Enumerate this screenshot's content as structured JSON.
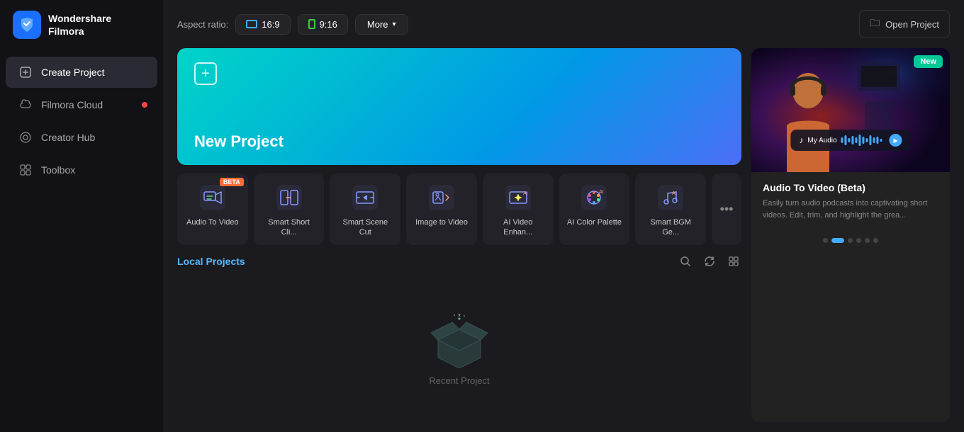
{
  "sidebar": {
    "logo": {
      "icon": "◆",
      "line1": "Wondershare",
      "line2": "Filmora"
    },
    "items": [
      {
        "id": "create-project",
        "label": "Create Project",
        "icon": "⊕",
        "active": true,
        "dot": false
      },
      {
        "id": "filmora-cloud",
        "label": "Filmora Cloud",
        "icon": "☁",
        "active": false,
        "dot": true
      },
      {
        "id": "creator-hub",
        "label": "Creator Hub",
        "icon": "◎",
        "active": false,
        "dot": false
      },
      {
        "id": "toolbox",
        "label": "Toolbox",
        "icon": "⊞",
        "active": false,
        "dot": false
      }
    ]
  },
  "topbar": {
    "aspect_label": "Aspect ratio:",
    "ratio_16_9": "16:9",
    "ratio_9_16": "9:16",
    "more_label": "More",
    "open_project_label": "Open Project"
  },
  "new_project": {
    "title": "New Project"
  },
  "ai_tools": [
    {
      "id": "audio-to-video",
      "label": "Audio To Video",
      "icon": "🎬",
      "beta": true
    },
    {
      "id": "smart-short-clip",
      "label": "Smart Short Cli...",
      "icon": "✂",
      "beta": false
    },
    {
      "id": "smart-scene-cut",
      "label": "Smart Scene Cut",
      "icon": "▶",
      "beta": false
    },
    {
      "id": "image-to-video",
      "label": "Image to Video",
      "icon": "🖼",
      "beta": false
    },
    {
      "id": "ai-video-enhance",
      "label": "AI Video Enhan...",
      "icon": "✦",
      "beta": false
    },
    {
      "id": "ai-color-palette",
      "label": "AI Color Palette",
      "icon": "🎨",
      "beta": false
    },
    {
      "id": "smart-bgm",
      "label": "Smart BGM Ge...",
      "icon": "♪",
      "beta": false
    }
  ],
  "more_tools": "•••",
  "local_projects": {
    "title": "Local Projects",
    "empty_text": "Recent Project",
    "tools": [
      {
        "id": "search",
        "icon": "🔍"
      },
      {
        "id": "refresh",
        "icon": "↻"
      },
      {
        "id": "grid",
        "icon": "⊞"
      }
    ]
  },
  "feature_card": {
    "new_badge": "New",
    "title": "Audio To Video (Beta)",
    "description": "Easily turn audio podcasts into captivating short videos. Edit, trim, and highlight the grea...",
    "audio_label": "My Audio",
    "dots": [
      0,
      1,
      2,
      3,
      4,
      5
    ],
    "active_dot": 1
  }
}
